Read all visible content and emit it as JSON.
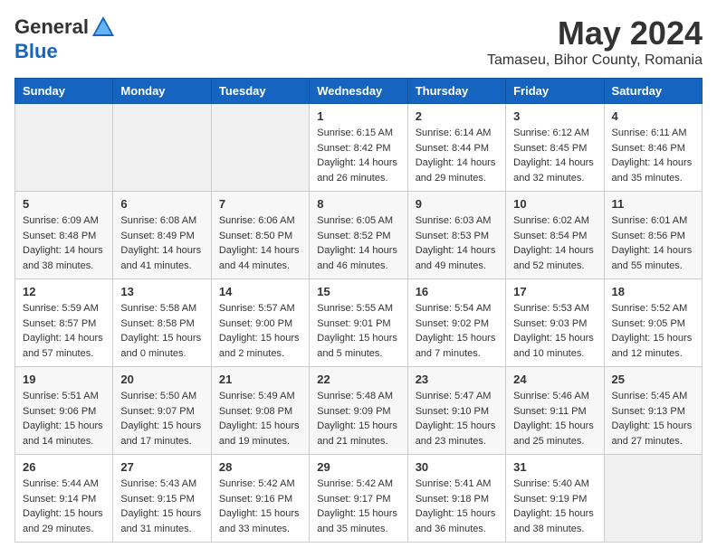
{
  "logo": {
    "general": "General",
    "blue": "Blue"
  },
  "title": "May 2024",
  "subtitle": "Tamaseu, Bihor County, Romania",
  "weekdays": [
    "Sunday",
    "Monday",
    "Tuesday",
    "Wednesday",
    "Thursday",
    "Friday",
    "Saturday"
  ],
  "weeks": [
    [
      {
        "day": "",
        "info": ""
      },
      {
        "day": "",
        "info": ""
      },
      {
        "day": "",
        "info": ""
      },
      {
        "day": "1",
        "info": "Sunrise: 6:15 AM\nSunset: 8:42 PM\nDaylight: 14 hours\nand 26 minutes."
      },
      {
        "day": "2",
        "info": "Sunrise: 6:14 AM\nSunset: 8:44 PM\nDaylight: 14 hours\nand 29 minutes."
      },
      {
        "day": "3",
        "info": "Sunrise: 6:12 AM\nSunset: 8:45 PM\nDaylight: 14 hours\nand 32 minutes."
      },
      {
        "day": "4",
        "info": "Sunrise: 6:11 AM\nSunset: 8:46 PM\nDaylight: 14 hours\nand 35 minutes."
      }
    ],
    [
      {
        "day": "5",
        "info": "Sunrise: 6:09 AM\nSunset: 8:48 PM\nDaylight: 14 hours\nand 38 minutes."
      },
      {
        "day": "6",
        "info": "Sunrise: 6:08 AM\nSunset: 8:49 PM\nDaylight: 14 hours\nand 41 minutes."
      },
      {
        "day": "7",
        "info": "Sunrise: 6:06 AM\nSunset: 8:50 PM\nDaylight: 14 hours\nand 44 minutes."
      },
      {
        "day": "8",
        "info": "Sunrise: 6:05 AM\nSunset: 8:52 PM\nDaylight: 14 hours\nand 46 minutes."
      },
      {
        "day": "9",
        "info": "Sunrise: 6:03 AM\nSunset: 8:53 PM\nDaylight: 14 hours\nand 49 minutes."
      },
      {
        "day": "10",
        "info": "Sunrise: 6:02 AM\nSunset: 8:54 PM\nDaylight: 14 hours\nand 52 minutes."
      },
      {
        "day": "11",
        "info": "Sunrise: 6:01 AM\nSunset: 8:56 PM\nDaylight: 14 hours\nand 55 minutes."
      }
    ],
    [
      {
        "day": "12",
        "info": "Sunrise: 5:59 AM\nSunset: 8:57 PM\nDaylight: 14 hours\nand 57 minutes."
      },
      {
        "day": "13",
        "info": "Sunrise: 5:58 AM\nSunset: 8:58 PM\nDaylight: 15 hours\nand 0 minutes."
      },
      {
        "day": "14",
        "info": "Sunrise: 5:57 AM\nSunset: 9:00 PM\nDaylight: 15 hours\nand 2 minutes."
      },
      {
        "day": "15",
        "info": "Sunrise: 5:55 AM\nSunset: 9:01 PM\nDaylight: 15 hours\nand 5 minutes."
      },
      {
        "day": "16",
        "info": "Sunrise: 5:54 AM\nSunset: 9:02 PM\nDaylight: 15 hours\nand 7 minutes."
      },
      {
        "day": "17",
        "info": "Sunrise: 5:53 AM\nSunset: 9:03 PM\nDaylight: 15 hours\nand 10 minutes."
      },
      {
        "day": "18",
        "info": "Sunrise: 5:52 AM\nSunset: 9:05 PM\nDaylight: 15 hours\nand 12 minutes."
      }
    ],
    [
      {
        "day": "19",
        "info": "Sunrise: 5:51 AM\nSunset: 9:06 PM\nDaylight: 15 hours\nand 14 minutes."
      },
      {
        "day": "20",
        "info": "Sunrise: 5:50 AM\nSunset: 9:07 PM\nDaylight: 15 hours\nand 17 minutes."
      },
      {
        "day": "21",
        "info": "Sunrise: 5:49 AM\nSunset: 9:08 PM\nDaylight: 15 hours\nand 19 minutes."
      },
      {
        "day": "22",
        "info": "Sunrise: 5:48 AM\nSunset: 9:09 PM\nDaylight: 15 hours\nand 21 minutes."
      },
      {
        "day": "23",
        "info": "Sunrise: 5:47 AM\nSunset: 9:10 PM\nDaylight: 15 hours\nand 23 minutes."
      },
      {
        "day": "24",
        "info": "Sunrise: 5:46 AM\nSunset: 9:11 PM\nDaylight: 15 hours\nand 25 minutes."
      },
      {
        "day": "25",
        "info": "Sunrise: 5:45 AM\nSunset: 9:13 PM\nDaylight: 15 hours\nand 27 minutes."
      }
    ],
    [
      {
        "day": "26",
        "info": "Sunrise: 5:44 AM\nSunset: 9:14 PM\nDaylight: 15 hours\nand 29 minutes."
      },
      {
        "day": "27",
        "info": "Sunrise: 5:43 AM\nSunset: 9:15 PM\nDaylight: 15 hours\nand 31 minutes."
      },
      {
        "day": "28",
        "info": "Sunrise: 5:42 AM\nSunset: 9:16 PM\nDaylight: 15 hours\nand 33 minutes."
      },
      {
        "day": "29",
        "info": "Sunrise: 5:42 AM\nSunset: 9:17 PM\nDaylight: 15 hours\nand 35 minutes."
      },
      {
        "day": "30",
        "info": "Sunrise: 5:41 AM\nSunset: 9:18 PM\nDaylight: 15 hours\nand 36 minutes."
      },
      {
        "day": "31",
        "info": "Sunrise: 5:40 AM\nSunset: 9:19 PM\nDaylight: 15 hours\nand 38 minutes."
      },
      {
        "day": "",
        "info": ""
      }
    ]
  ]
}
